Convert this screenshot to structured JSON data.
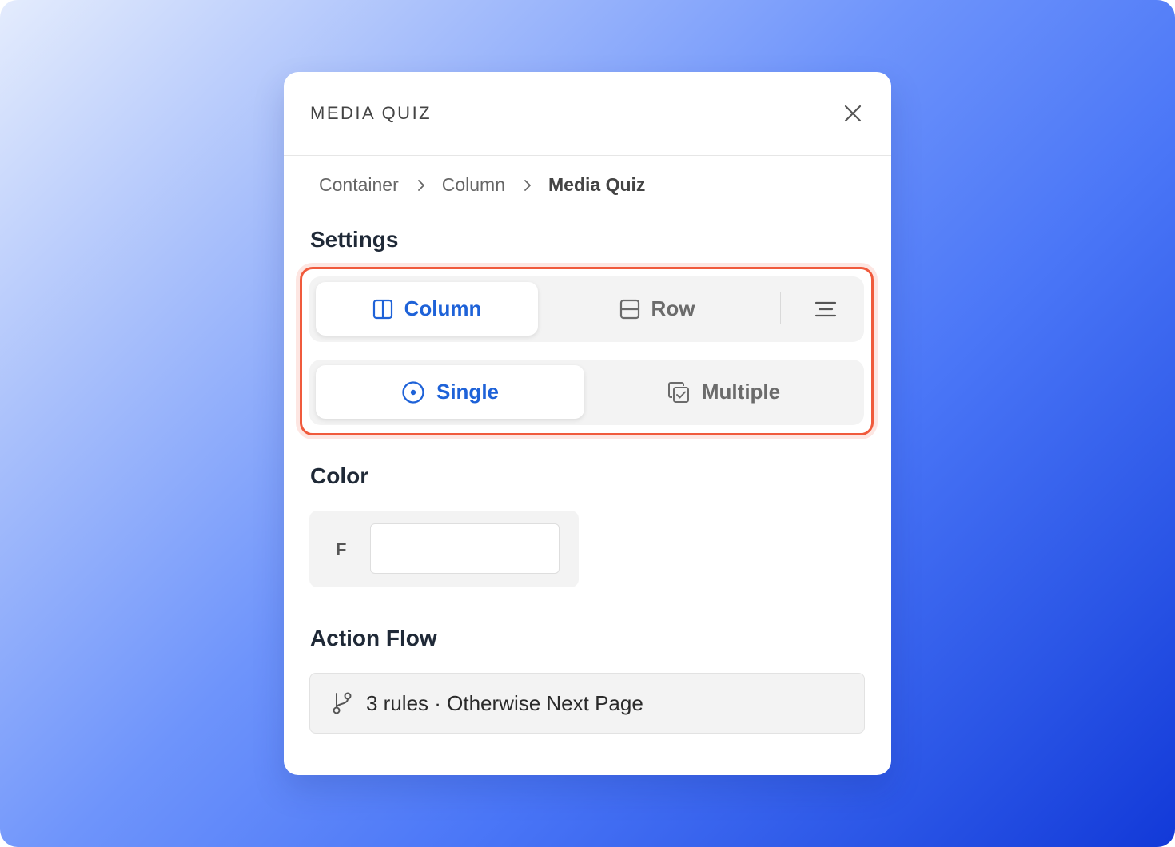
{
  "panel": {
    "title": "MEDIA QUIZ"
  },
  "breadcrumb": {
    "items": [
      "Container",
      "Column",
      "Media Quiz"
    ]
  },
  "settings": {
    "title": "Settings",
    "layout": {
      "options": [
        {
          "label": "Column",
          "icon": "columns-icon",
          "active": true
        },
        {
          "label": "Row",
          "icon": "rows-icon",
          "active": false
        }
      ],
      "extra_icon": "align-center-icon"
    },
    "selection": {
      "options": [
        {
          "label": "Single",
          "icon": "radio-icon",
          "active": true
        },
        {
          "label": "Multiple",
          "icon": "multi-check-icon",
          "active": false
        }
      ]
    }
  },
  "color": {
    "title": "Color",
    "letter": "F",
    "value": ""
  },
  "action_flow": {
    "title": "Action Flow",
    "summary": "3 rules · Otherwise Next Page",
    "icon": "branch-icon"
  },
  "colors": {
    "accent": "#1e62d8",
    "highlight": "#f05a3c"
  }
}
